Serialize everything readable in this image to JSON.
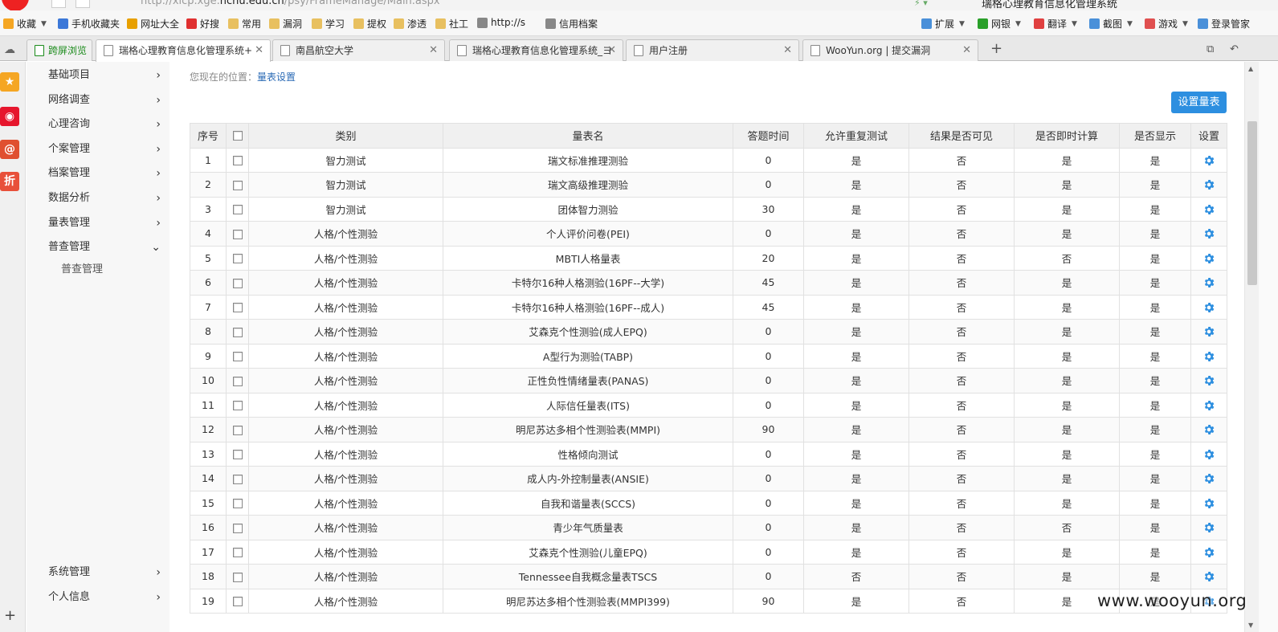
{
  "address_bar": {
    "url_pre": "http://xlcp.xge.",
    "url_host": "ncnu.edu.cn",
    "url_post": "/psy/FrameManage/Main.aspx",
    "search_title": "瑞格心理教育信息化管理系统"
  },
  "bookmarks": [
    {
      "label": "收藏",
      "icon": "star-icon",
      "color": "#f5a623",
      "dropdown": true
    },
    {
      "label": "手机收藏夹",
      "icon": "phone-icon",
      "color": "#3c78d8"
    },
    {
      "label": "网址大全",
      "icon": "globe-icon",
      "color": "#e8a000"
    },
    {
      "label": "好搜",
      "icon": "haosou-icon",
      "color": "#e03030"
    },
    {
      "label": "常用",
      "icon": "folder-icon",
      "color": "#e8c060"
    },
    {
      "label": "漏洞",
      "icon": "folder-icon",
      "color": "#e8c060"
    },
    {
      "label": "学习",
      "icon": "folder-icon",
      "color": "#e8c060"
    },
    {
      "label": "提权",
      "icon": "folder-icon",
      "color": "#e8c060"
    },
    {
      "label": "渗透",
      "icon": "folder-icon",
      "color": "#e8c060"
    },
    {
      "label": "社工",
      "icon": "folder-icon",
      "color": "#e8c060"
    },
    {
      "label": "http://s",
      "icon": "page-icon",
      "color": "#888888"
    },
    {
      "label": "信用档案",
      "icon": "page-icon",
      "color": "#888888"
    }
  ],
  "tools": [
    {
      "label": "扩展",
      "icon": "grid-icon",
      "color": "#4a90d9"
    },
    {
      "label": "网银",
      "icon": "yen-icon",
      "color": "#2aa02a"
    },
    {
      "label": "翻译",
      "icon": "translate-icon",
      "color": "#e04040"
    },
    {
      "label": "截图",
      "icon": "scissors-icon",
      "color": "#4a90d9"
    },
    {
      "label": "游戏",
      "icon": "gamepad-icon",
      "color": "#e05050"
    },
    {
      "label": "登录管家",
      "icon": "key-icon",
      "color": "#4a90d9"
    }
  ],
  "tabs": [
    {
      "label": "跨屏浏览",
      "kind": "split"
    },
    {
      "label": "瑞格心理教育信息化管理系统+",
      "active": true
    },
    {
      "label": "南昌航空大学"
    },
    {
      "label": "瑞格心理教育信息化管理系统_ヨ"
    },
    {
      "label": "用户注册"
    },
    {
      "label": "WooYun.org | 提交漏洞"
    }
  ],
  "browser_sidebar": [
    {
      "icon": "star-icon",
      "color": "#f5a623",
      "glyph": "★"
    },
    {
      "icon": "weibo-icon",
      "color": "#e6162d",
      "glyph": "◉"
    },
    {
      "icon": "mail-icon",
      "color": "#e05030",
      "glyph": "@"
    },
    {
      "icon": "discount-icon",
      "color": "#e8503a",
      "glyph": "折"
    }
  ],
  "nav": {
    "items": [
      {
        "label": "基础项目",
        "expanded": false
      },
      {
        "label": "网络调查",
        "expanded": false
      },
      {
        "label": "心理咨询",
        "expanded": false
      },
      {
        "label": "个案管理",
        "expanded": false
      },
      {
        "label": "档案管理",
        "expanded": false
      },
      {
        "label": "数据分析",
        "expanded": false
      },
      {
        "label": "量表管理",
        "expanded": false
      },
      {
        "label": "普查管理",
        "expanded": true
      }
    ],
    "sub": "普查管理",
    "bottom": [
      {
        "label": "系统管理"
      },
      {
        "label": "个人信息"
      }
    ]
  },
  "breadcrumb": {
    "prefix": "您现在的位置：",
    "current": "量表设置"
  },
  "setup_button": "设置量表",
  "table": {
    "headers": [
      "序号",
      "",
      "类别",
      "量表名",
      "答题时间",
      "允许重复测试",
      "结果是否可见",
      "是否即时计算",
      "是否显示",
      "设置"
    ],
    "rows": [
      [
        "1",
        "智力测试",
        "瑞文标准推理测验",
        "0",
        "是",
        "否",
        "是",
        "是"
      ],
      [
        "2",
        "智力测试",
        "瑞文高级推理测验",
        "0",
        "是",
        "否",
        "是",
        "是"
      ],
      [
        "3",
        "智力测试",
        "团体智力测验",
        "30",
        "是",
        "否",
        "是",
        "是"
      ],
      [
        "4",
        "人格/个性测验",
        "个人评价问卷(PEI)",
        "0",
        "是",
        "否",
        "是",
        "是"
      ],
      [
        "5",
        "人格/个性测验",
        "MBTI人格量表",
        "20",
        "是",
        "否",
        "否",
        "是"
      ],
      [
        "6",
        "人格/个性测验",
        "卡特尔16种人格测验(16PF--大学)",
        "45",
        "是",
        "否",
        "是",
        "是"
      ],
      [
        "7",
        "人格/个性测验",
        "卡特尔16种人格测验(16PF--成人)",
        "45",
        "是",
        "否",
        "是",
        "是"
      ],
      [
        "8",
        "人格/个性测验",
        "艾森克个性测验(成人EPQ)",
        "0",
        "是",
        "否",
        "是",
        "是"
      ],
      [
        "9",
        "人格/个性测验",
        "A型行为测验(TABP)",
        "0",
        "是",
        "否",
        "是",
        "是"
      ],
      [
        "10",
        "人格/个性测验",
        "正性负性情绪量表(PANAS)",
        "0",
        "是",
        "否",
        "是",
        "是"
      ],
      [
        "11",
        "人格/个性测验",
        "人际信任量表(ITS)",
        "0",
        "是",
        "否",
        "是",
        "是"
      ],
      [
        "12",
        "人格/个性测验",
        "明尼苏达多相个性测验表(MMPI)",
        "90",
        "是",
        "否",
        "是",
        "是"
      ],
      [
        "13",
        "人格/个性测验",
        "性格倾向测试",
        "0",
        "是",
        "否",
        "是",
        "是"
      ],
      [
        "14",
        "人格/个性测验",
        "成人内-外控制量表(ANSIE)",
        "0",
        "是",
        "否",
        "是",
        "是"
      ],
      [
        "15",
        "人格/个性测验",
        "自我和谐量表(SCCS)",
        "0",
        "是",
        "否",
        "是",
        "是"
      ],
      [
        "16",
        "人格/个性测验",
        "青少年气质量表",
        "0",
        "是",
        "否",
        "否",
        "是"
      ],
      [
        "17",
        "人格/个性测验",
        "艾森克个性测验(儿童EPQ)",
        "0",
        "是",
        "否",
        "是",
        "是"
      ],
      [
        "18",
        "人格/个性测验",
        "Tennessee自我概念量表TSCS",
        "0",
        "否",
        "否",
        "是",
        "是"
      ],
      [
        "19",
        "人格/个性测验",
        "明尼苏达多相个性测验表(MMPI399)",
        "90",
        "是",
        "否",
        "是",
        "是"
      ]
    ]
  },
  "watermark": "www.wooyun.org",
  "colors": {
    "accent": "#2d8fe0",
    "gear": "#2d8fe0"
  }
}
